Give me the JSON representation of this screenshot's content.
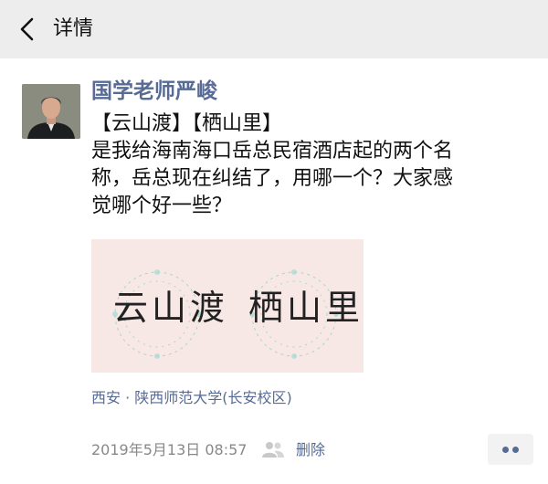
{
  "header": {
    "title": "详情"
  },
  "post": {
    "author": "国学老师严峻",
    "lines": [
      "【云山渡】【栖山里】",
      "是我给海南海口岳总民宿酒店起的两个名",
      "称，岳总现在纠结了，用哪一个？大家感",
      "觉哪个好一些？"
    ],
    "image_texts": [
      "云山渡",
      "栖山里"
    ],
    "location": "西安 · 陕西师范大学(长安校区)",
    "timestamp": "2019年5月13日 08:57",
    "delete_label": "删除"
  },
  "colors": {
    "link": "#576b95",
    "header_bg": "#ededed",
    "image_bg": "#f7e8e6"
  },
  "icons": [
    "back-arrow-icon",
    "friends-visibility-icon",
    "more-dots-icon"
  ]
}
